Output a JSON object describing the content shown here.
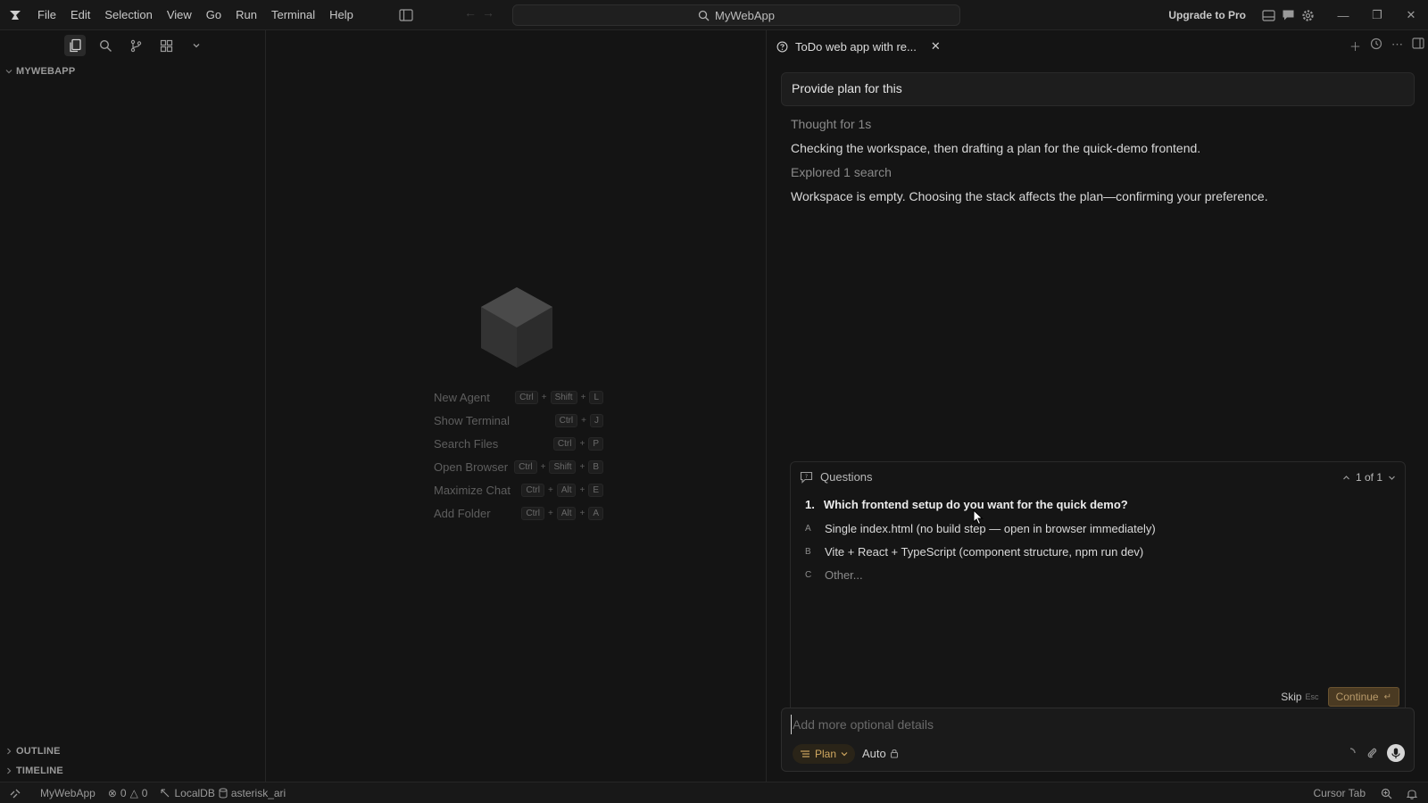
{
  "titlebar": {
    "menu": [
      "File",
      "Edit",
      "Selection",
      "View",
      "Go",
      "Run",
      "Terminal",
      "Help"
    ],
    "search_label": "MyWebApp",
    "upgrade_label": "Upgrade to Pro"
  },
  "sidebar": {
    "explorer_title": "MYWEBAPP",
    "outline_label": "OUTLINE",
    "timeline_label": "TIMELINE"
  },
  "editor": {
    "shortcuts": [
      {
        "label": "New Agent",
        "keys": [
          "Ctrl",
          "+",
          "Shift",
          "+",
          "L"
        ]
      },
      {
        "label": "Show Terminal",
        "keys": [
          "Ctrl",
          "+",
          "J"
        ]
      },
      {
        "label": "Search Files",
        "keys": [
          "Ctrl",
          "+",
          "P"
        ]
      },
      {
        "label": "Open Browser",
        "keys": [
          "Ctrl",
          "+",
          "Shift",
          "+",
          "B"
        ]
      },
      {
        "label": "Maximize Chat",
        "keys": [
          "Ctrl",
          "+",
          "Alt",
          "+",
          "E"
        ]
      },
      {
        "label": "Add Folder",
        "keys": [
          "Ctrl",
          "+",
          "Alt",
          "+",
          "A"
        ]
      }
    ]
  },
  "chat": {
    "tab_title": "ToDo web app with re...",
    "user_message": "Provide plan for this",
    "thought_label": "Thought",
    "thought_duration": "for 1s",
    "line1": "Checking the workspace, then drafting a plan for the quick-demo frontend.",
    "explored_label": "Explored",
    "explored_detail": "1 search",
    "line2": "Workspace is empty. Choosing the stack affects the plan—confirming your preference.",
    "questions": {
      "header": "Questions",
      "pager": "1 of 1",
      "number": "1.",
      "question": "Which frontend setup do you want for the quick demo?",
      "options": [
        {
          "letter": "A",
          "text": "Single index.html (no build step — open in browser immediately)"
        },
        {
          "letter": "B",
          "text": "Vite + React + TypeScript (component structure, npm run dev)"
        },
        {
          "letter": "C",
          "text": "Other..."
        }
      ],
      "skip_label": "Skip",
      "skip_key": "Esc",
      "continue_label": "Continue"
    },
    "composer": {
      "placeholder": "Add more optional details",
      "mode": "Plan",
      "model": "Auto"
    }
  },
  "statusbar": {
    "project": "MyWebApp",
    "errors": "0",
    "warnings": "0",
    "db": "LocalDB",
    "db_name": "asterisk_ari",
    "cursor_tab": "Cursor Tab"
  }
}
